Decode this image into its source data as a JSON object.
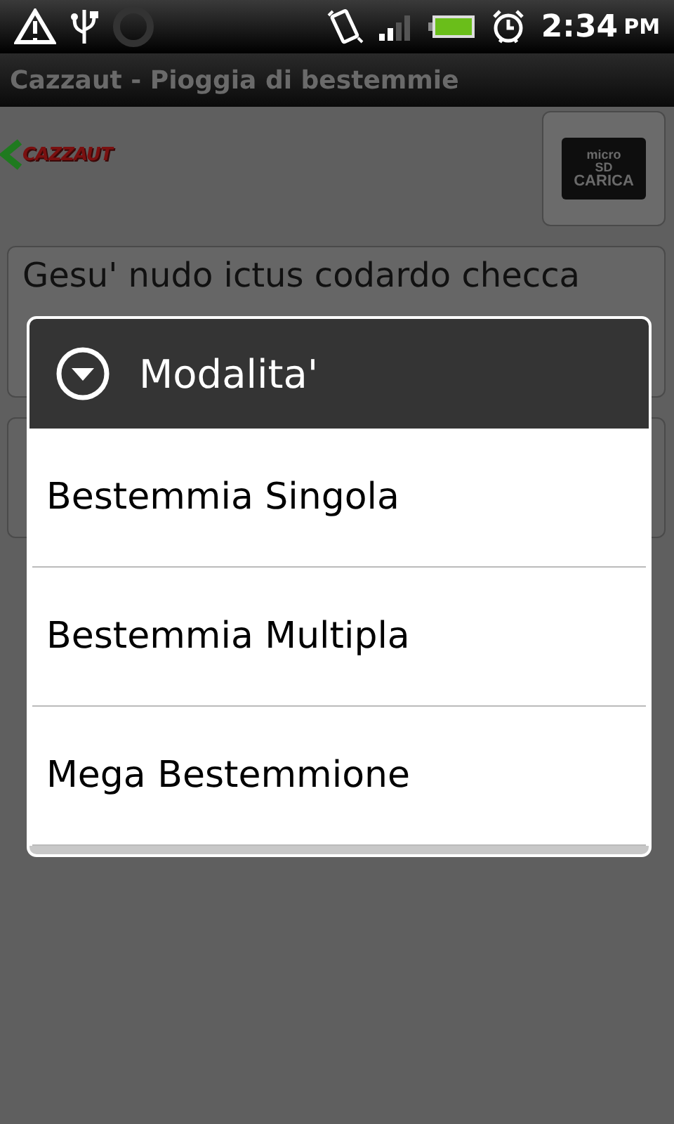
{
  "status_bar": {
    "time": "2:34",
    "ampm": "PM"
  },
  "title_bar": {
    "title": "Cazzaut - Pioggia di bestemmie"
  },
  "logo": {
    "text": "CAZZAUT"
  },
  "sd_button": {
    "top": "micro",
    "middle": "SD",
    "bottom": "CARICA"
  },
  "text_box": {
    "value": "Gesu' nudo ictus codardo checca"
  },
  "dialog": {
    "title": "Modalita'",
    "items": [
      {
        "label": "Bestemmia Singola"
      },
      {
        "label": "Bestemmia Multipla"
      },
      {
        "label": "Mega Bestemmione"
      }
    ]
  }
}
